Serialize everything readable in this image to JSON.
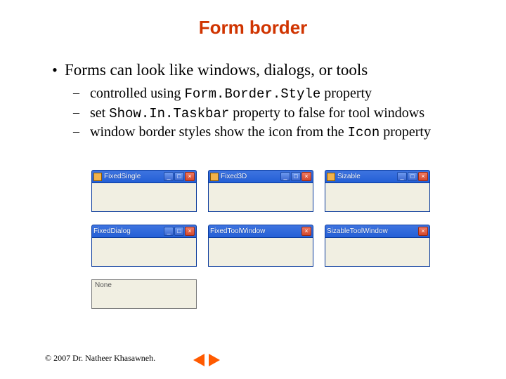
{
  "title": "Form border",
  "points": {
    "p1": "Forms can look like windows, dialogs, or tools",
    "s1a": "controlled using ",
    "s1b": "Form.Border.Style",
    "s1c": " property",
    "s2a": "set ",
    "s2b": "Show.In.Taskbar",
    "s2c": " property to false for tool windows",
    "s3a": "window border styles show the icon from the ",
    "s3b": "Icon",
    "s3c": " property"
  },
  "samples": {
    "fixedSingle": {
      "title": "FixedSingle",
      "icon": true,
      "min": true,
      "max": true,
      "close": true,
      "border": true
    },
    "fixed3d": {
      "title": "Fixed3D",
      "icon": true,
      "min": true,
      "max": true,
      "close": true,
      "border": true
    },
    "sizable": {
      "title": "Sizable",
      "icon": true,
      "min": true,
      "max": true,
      "close": true,
      "border": true
    },
    "fixedDialog": {
      "title": "FixedDialog",
      "icon": false,
      "min": true,
      "max": true,
      "close": true,
      "border": true
    },
    "fixedToolWindow": {
      "title": "FixedToolWindow",
      "icon": false,
      "min": false,
      "max": false,
      "close": true,
      "border": true
    },
    "sizableTool": {
      "title": "SizableToolWindow",
      "icon": false,
      "min": false,
      "max": false,
      "close": true,
      "border": true
    },
    "none": {
      "title": "None",
      "icon": false,
      "min": false,
      "max": false,
      "close": false,
      "border": false
    }
  },
  "footer": {
    "copyright": "© 2007 Dr. Natheer Khasawneh."
  },
  "glyphs": {
    "bullet1": "•",
    "bullet2": "–",
    "min": "_",
    "max": "□",
    "close": "×"
  }
}
